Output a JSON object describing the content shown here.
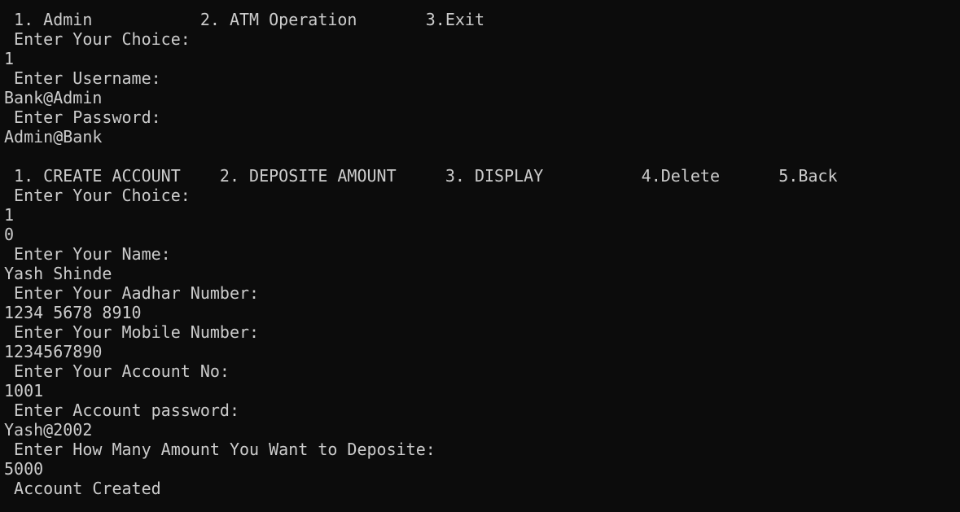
{
  "terminal": {
    "lines": [
      " 1. Admin           2. ATM Operation       3.Exit",
      " Enter Your Choice:",
      "1",
      " Enter Username:",
      "Bank@Admin",
      " Enter Password:",
      "Admin@Bank",
      "",
      " 1. CREATE ACCOUNT    2. DEPOSITE AMOUNT     3. DISPLAY          4.Delete      5.Back",
      " Enter Your Choice:",
      "1",
      "0",
      " Enter Your Name:",
      "Yash Shinde",
      " Enter Your Aadhar Number:",
      "1234 5678 8910",
      " Enter Your Mobile Number:",
      "1234567890",
      " Enter Your Account No:",
      "1001",
      " Enter Account password:",
      "Yash@2002",
      " Enter How Many Amount You Want to Deposite:",
      "5000",
      " Account Created"
    ]
  },
  "colors": {
    "background": "#0c0c0c",
    "foreground": "#cccccc"
  }
}
